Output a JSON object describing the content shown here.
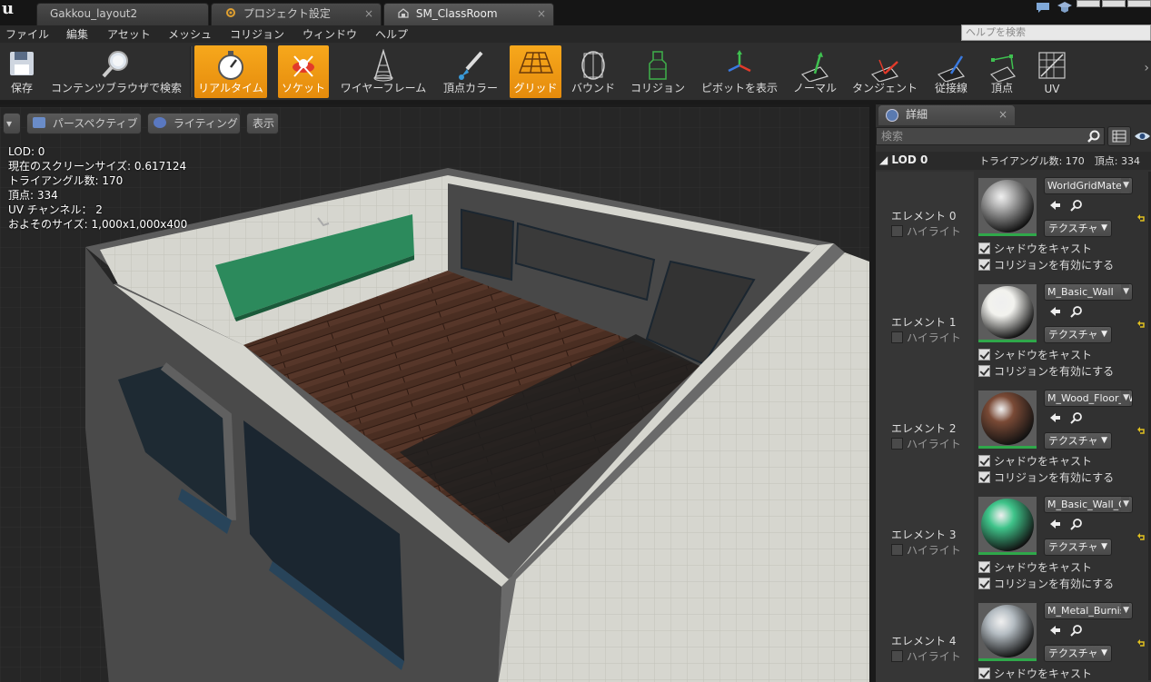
{
  "app": {
    "logo_text": "u"
  },
  "tabs": [
    {
      "label": "Gakkou_layout2",
      "close": "×",
      "icon": "level-icon"
    },
    {
      "label": "プロジェクト設定",
      "close": "×",
      "icon": "settings-icon"
    },
    {
      "label": "SM_ClassRoom",
      "close": "×",
      "icon": "static-mesh-icon"
    }
  ],
  "menu": [
    "ファイル",
    "編集",
    "アセット",
    "メッシュ",
    "コリジョン",
    "ウィンドウ",
    "ヘルプ"
  ],
  "help_search_placeholder": "ヘルプを検索",
  "toolbar": [
    {
      "label": "保存",
      "icon": "save-icon",
      "active": false
    },
    {
      "label": "コンテンツブラウザで検索",
      "icon": "find-in-browser-icon",
      "active": false
    },
    {
      "label": "リアルタイム",
      "icon": "realtime-stopwatch-icon",
      "active": true
    },
    {
      "label": "ソケット",
      "icon": "socket-icon",
      "active": true
    },
    {
      "label": "ワイヤーフレーム",
      "icon": "wireframe-icon",
      "active": false
    },
    {
      "label": "頂点カラー",
      "icon": "vertex-color-icon",
      "active": false
    },
    {
      "label": "グリッド",
      "icon": "grid-icon",
      "active": true
    },
    {
      "label": "バウンド",
      "icon": "bounds-icon",
      "active": false
    },
    {
      "label": "コリジョン",
      "icon": "collision-icon",
      "active": false
    },
    {
      "label": "ピボットを表示",
      "icon": "pivot-icon",
      "active": false
    },
    {
      "label": "ノーマル",
      "icon": "normals-icon",
      "active": false
    },
    {
      "label": "タンジェント",
      "icon": "tangents-icon",
      "active": false
    },
    {
      "label": "従接線",
      "icon": "binormals-icon",
      "active": false
    },
    {
      "label": "頂点",
      "icon": "vertices-icon",
      "active": false
    },
    {
      "label": "UV",
      "icon": "uv-icon",
      "active": false
    }
  ],
  "toolbar_more": "›",
  "viewport": {
    "menu_button": "▾",
    "perspective": "パースペクティブ",
    "lighting": "ライティング",
    "show": "表示",
    "stats": [
      "LOD: 0",
      "現在のスクリーンサイズ: 0.617124",
      "トライアングル数: 170",
      "頂点: 334",
      "UV チャンネル： 2",
      "およそのサイズ: 1,000x1,000x400"
    ]
  },
  "details": {
    "tab_label": "詳細",
    "tab_close": "×",
    "search_placeholder": "検索",
    "lod_title": "LOD 0",
    "lod_stats": "トライアングル数: 170　頂点: 334",
    "highlight_label": "ハイライト",
    "texture_label": "テクスチャ",
    "cast_shadow_label": "シャドウをキャスト",
    "collision_label": "コリジョンを有効にする",
    "elements": [
      {
        "name": "エレメント 0",
        "material": "WorldGridMateri",
        "sphere": "#a7a7a7",
        "highlight": false,
        "cast_shadow": true,
        "collision": true
      },
      {
        "name": "エレメント 1",
        "material": "M_Basic_Wall",
        "sphere": "#f2f2ee",
        "highlight": false,
        "cast_shadow": true,
        "collision": true
      },
      {
        "name": "エレメント 2",
        "material": "M_Wood_Floor_W",
        "sphere": "#7a4a36",
        "highlight": false,
        "cast_shadow": true,
        "collision": true
      },
      {
        "name": "エレメント 3",
        "material": "M_Basic_Wall_G",
        "sphere": "#3fc48a",
        "highlight": false,
        "cast_shadow": true,
        "collision": true
      },
      {
        "name": "エレメント 4",
        "material": "M_Metal_Burnis",
        "sphere": "#b4bcc2",
        "highlight": false,
        "cast_shadow": true,
        "collision": null
      }
    ]
  },
  "colors": {
    "accent_active": "#f0a01a",
    "panel": "#313131",
    "viewport_bg": "#262626"
  }
}
